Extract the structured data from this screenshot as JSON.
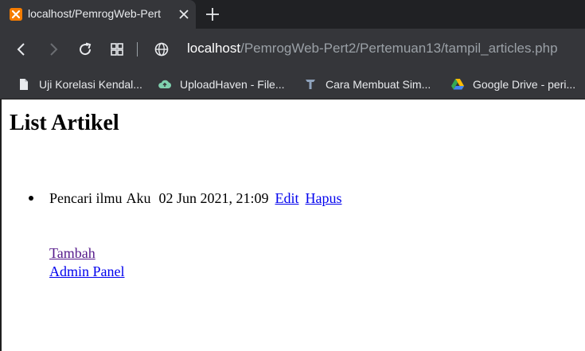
{
  "browser": {
    "tab_title": "localhost/PemrogWeb-Pert",
    "url_host": "localhost",
    "url_path": "/PemrogWeb-Pert2/Pertemuan13/tampil_articles.php",
    "bookmarks": [
      {
        "label": "Uji Korelasi Kendal...",
        "icon": "page-icon"
      },
      {
        "label": "UploadHaven - File...",
        "icon": "cloud-upload-icon"
      },
      {
        "label": "Cara Membuat Sim...",
        "icon": "site-favicon-icon"
      },
      {
        "label": "Google Drive - peri...",
        "icon": "google-drive-icon"
      }
    ],
    "colors": {
      "tabstrip": "#202124",
      "toolbar": "#35363a",
      "text": "#e8eaed"
    }
  },
  "page": {
    "title": "List Artikel",
    "articles": [
      {
        "title": "Pencari ilmu",
        "author": "Aku",
        "date": "02 Jun 2021, 21:09",
        "edit_label": "Edit",
        "delete_label": "Hapus"
      }
    ],
    "add_label": "Tambah",
    "admin_label": "Admin Panel",
    "colors": {
      "link": "#0000ee",
      "visited_link": "#551a8b"
    }
  }
}
